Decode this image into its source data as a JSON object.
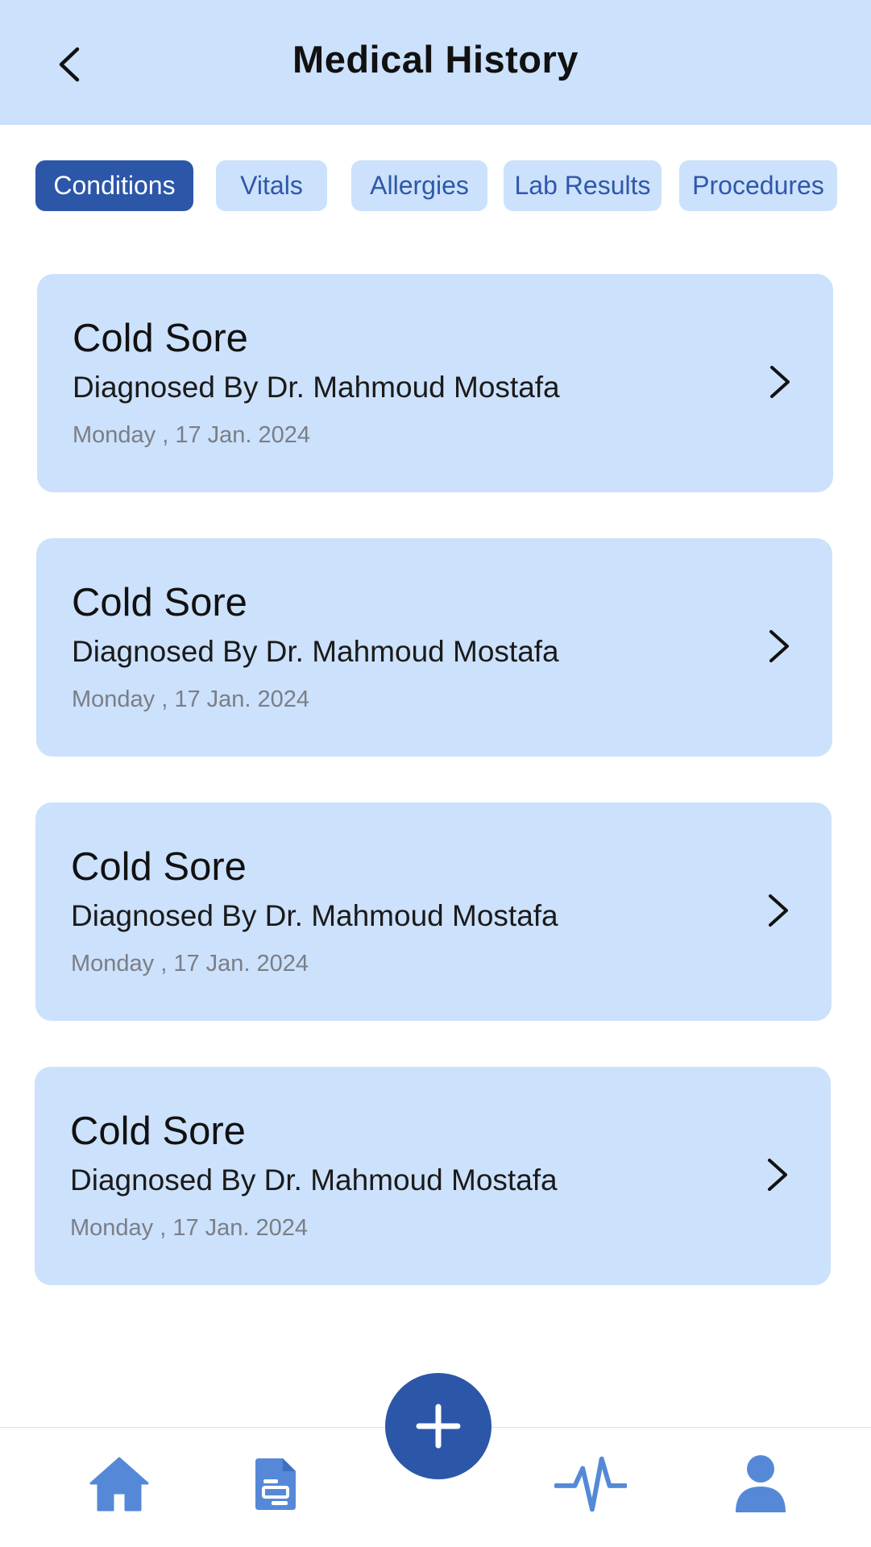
{
  "header": {
    "title": "Medical History",
    "back_icon": "chevron-left-icon"
  },
  "tabs": [
    {
      "label": "Conditions",
      "active": true
    },
    {
      "label": "Vitals",
      "active": false
    },
    {
      "label": "Allergies",
      "active": false
    },
    {
      "label": "Lab Results",
      "active": false
    },
    {
      "label": "Procedures",
      "active": false
    }
  ],
  "conditions": [
    {
      "title": "Cold Sore",
      "diagnosed_by": "Diagnosed By Dr. Mahmoud Mostafa",
      "date": "Monday , 17 Jan. 2024"
    },
    {
      "title": "Cold Sore",
      "diagnosed_by": "Diagnosed By Dr. Mahmoud Mostafa",
      "date": "Monday , 17 Jan. 2024"
    },
    {
      "title": "Cold Sore",
      "diagnosed_by": "Diagnosed By Dr. Mahmoud Mostafa",
      "date": "Monday , 17 Jan. 2024"
    },
    {
      "title": "Cold Sore",
      "diagnosed_by": "Diagnosed By Dr. Mahmoud Mostafa",
      "date": "Monday , 17 Jan. 2024"
    }
  ],
  "bottom_nav": {
    "items": [
      "home-icon",
      "document-icon",
      "add-icon",
      "pulse-icon",
      "profile-icon"
    ]
  },
  "colors": {
    "header_bg": "#cce1fb",
    "card_bg": "#cce1fb",
    "accent": "#2c56a8",
    "tab_text": "#2e58a9",
    "nav_icon": "#5589d8",
    "date_text": "#7b7e86"
  }
}
